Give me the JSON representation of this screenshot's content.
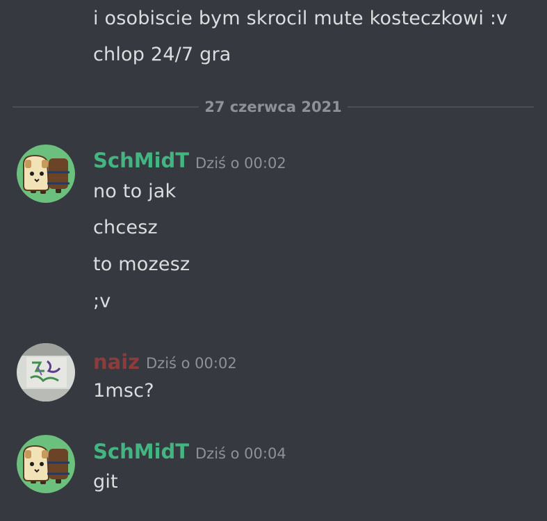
{
  "theme": {
    "background": "#36393f",
    "text": "#dcddde",
    "muted": "#8e9297",
    "schmidt_color": "#43b581",
    "naiz_color": "#8e3b3b"
  },
  "previous_messages": [
    "i osobiscie bym skrocil mute kosteczkowi :v",
    "chlop 24/7 gra"
  ],
  "date_divider": "27 czerwca 2021",
  "groups": [
    {
      "author": "SchMidT",
      "timestamp": "Dziś o 00:02",
      "avatar_icon": "bread-dog-avatar-icon",
      "messages": [
        "no to jak",
        "chcesz",
        "to mozesz",
        ";v"
      ]
    },
    {
      "author": "naiz",
      "timestamp": "Dziś o 00:02",
      "avatar_icon": "graffiti-wall-avatar-icon",
      "messages": [
        "1msc?"
      ]
    },
    {
      "author": "SchMidT",
      "timestamp": "Dziś o 00:04",
      "avatar_icon": "bread-dog-avatar-icon",
      "messages": [
        "git"
      ]
    }
  ]
}
